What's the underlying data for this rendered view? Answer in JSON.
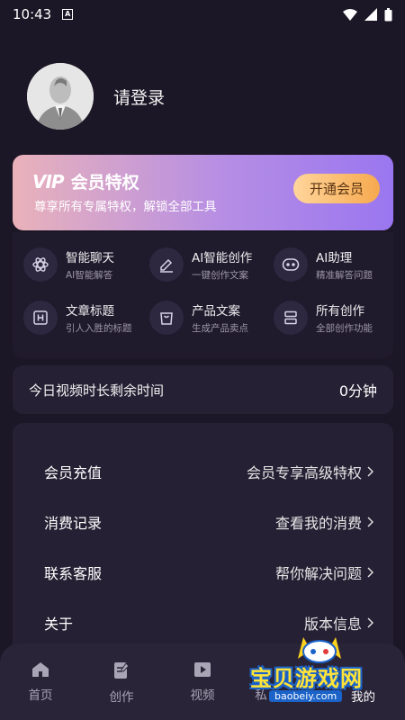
{
  "status": {
    "time": "10:43",
    "notif": "A"
  },
  "profile": {
    "login": "请登录"
  },
  "vip": {
    "logo": "VIP",
    "title": "会员特权",
    "subtitle": "尊享所有专属特权，解锁全部工具",
    "button": "开通会员"
  },
  "tools": [
    {
      "name": "智能聊天",
      "desc": "AI智能解答",
      "icon": "atom-icon"
    },
    {
      "name": "AI智能创作",
      "desc": "一键创作文案",
      "icon": "pen-icon"
    },
    {
      "name": "AI助理",
      "desc": "精准解答问题",
      "icon": "robot-icon"
    },
    {
      "name": "文章标题",
      "desc": "引人入胜的标题",
      "icon": "heading-icon"
    },
    {
      "name": "产品文案",
      "desc": "生成产品卖点",
      "icon": "bag-icon"
    },
    {
      "name": "所有创作",
      "desc": "全部创作功能",
      "icon": "stack-icon"
    }
  ],
  "video_time": {
    "label": "今日视频时长剩余时间",
    "value": "0分钟"
  },
  "menu": [
    {
      "label": "会员充值",
      "value": "会员专享高级特权"
    },
    {
      "label": "消费记录",
      "value": "查看我的消费"
    },
    {
      "label": "联系客服",
      "value": "帮你解决问题"
    },
    {
      "label": "关于",
      "value": "版本信息"
    }
  ],
  "tabs": [
    {
      "label": "首页",
      "icon": "home-icon"
    },
    {
      "label": "创作",
      "icon": "document-icon"
    },
    {
      "label": "视频",
      "icon": "play-icon"
    },
    {
      "label": "私",
      "icon": ""
    },
    {
      "label": "我的",
      "icon": ""
    }
  ],
  "watermark": {
    "text": "宝贝游戏网",
    "url": "baobeiy.com"
  },
  "colors": {
    "background": "#1c1726",
    "card": "#262034",
    "vip_gradient_start": "#e9b2ba",
    "vip_gradient_end": "#9a76f0",
    "vip_button": "#f6a94e"
  }
}
